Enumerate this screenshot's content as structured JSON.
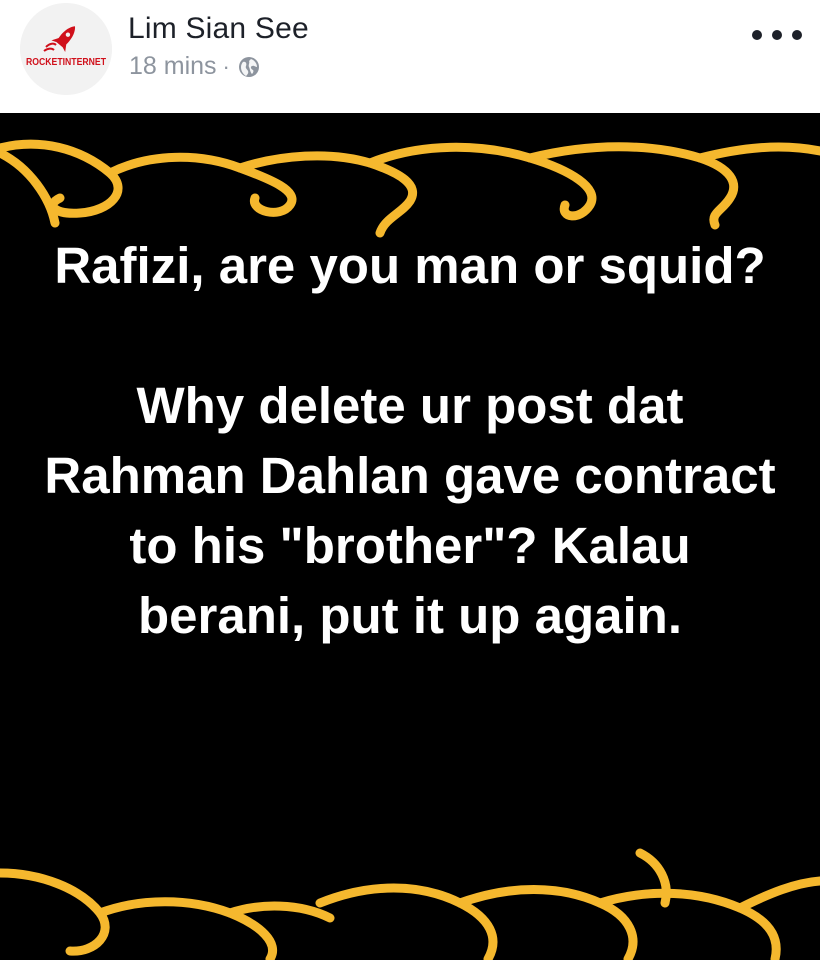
{
  "post": {
    "author": "Lim Sian See",
    "time": "18 mins",
    "separator": "·",
    "privacy_icon": "globe-icon",
    "avatar_label": "ROCKETINTERNET",
    "more_icon": "more-options-icon"
  },
  "image": {
    "text": "Rafizi, are you man or squid?\n\nWhy delete ur post dat Rahman Dahlan gave contract to his \"brother\"? Kalau berani, put it up again.",
    "background": "#000000",
    "text_color": "#ffffff",
    "accent_color": "#f5b82e"
  }
}
